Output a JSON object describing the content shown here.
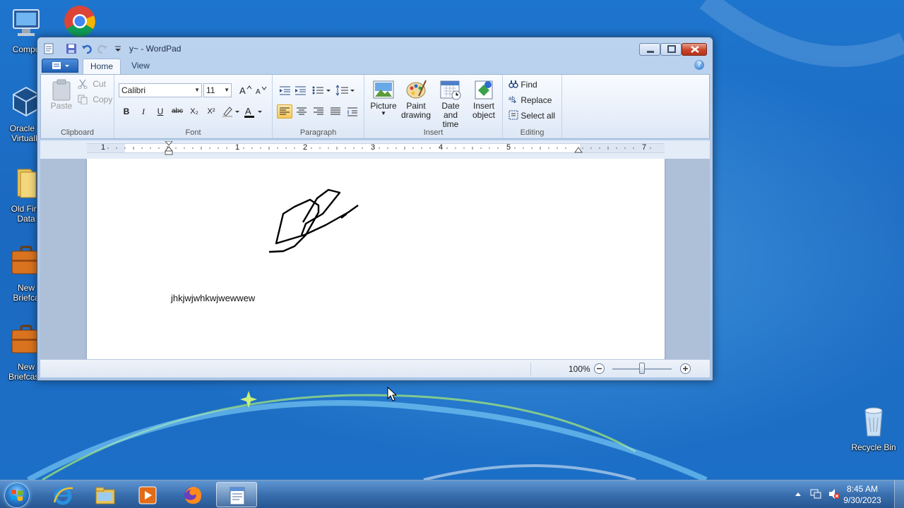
{
  "desktop": {
    "icons": [
      {
        "label": "Compu"
      },
      {
        "label": "Oracle V\nVirtualB"
      },
      {
        "label": "Old Fire\nData"
      },
      {
        "label": "New\nBriefca"
      },
      {
        "label": "New\nBriefcase"
      },
      {
        "label": "Recycle Bin"
      }
    ]
  },
  "window": {
    "title": "y~ - WordPad",
    "app_menu_icon": "document-menu-icon",
    "tabs": [
      {
        "label": "Home"
      },
      {
        "label": "View"
      }
    ],
    "help_glyph": "?"
  },
  "ribbon": {
    "clipboard": {
      "label": "Clipboard",
      "paste": "Paste",
      "cut": "Cut",
      "copy": "Copy"
    },
    "font": {
      "label": "Font",
      "family": "Calibri",
      "size": "11",
      "bold": "B",
      "italic": "I",
      "underline": "U",
      "strike": "abc",
      "subscript": "X₂",
      "superscript": "X²"
    },
    "paragraph": {
      "label": "Paragraph"
    },
    "insert": {
      "label": "Insert",
      "picture": "Picture",
      "paint_drawing": "Paint\ndrawing",
      "date_time": "Date and\ntime",
      "insert_object": "Insert\nobject"
    },
    "editing": {
      "label": "Editing",
      "find": "Find",
      "replace": "Replace",
      "select_all": "Select all"
    }
  },
  "ruler": {
    "ticks": [
      "1",
      "1",
      "2",
      "3",
      "4",
      "5",
      "7"
    ]
  },
  "document": {
    "text": "jhkjwjwhkwjwewwew"
  },
  "status": {
    "zoom": "100%",
    "zoom_level_percent": 100
  },
  "taskbar": {
    "time": "8:45 AM",
    "date": "9/30/2023"
  },
  "colors": {
    "accent": "#1f5fb4",
    "selected": "#f8c85a",
    "close": "#c9452c"
  }
}
